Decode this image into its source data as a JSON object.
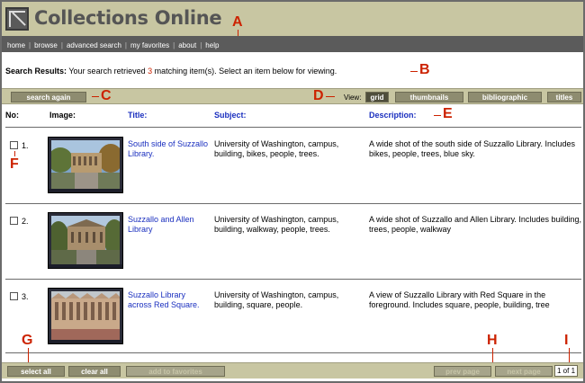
{
  "site": {
    "title": "Collections Online"
  },
  "nav": {
    "items": [
      "home",
      "browse",
      "advanced search",
      "my favorites",
      "about",
      "help"
    ],
    "separator": "|"
  },
  "search": {
    "label": "Search Results:",
    "text_before": "Your search retrieved",
    "count": "3",
    "text_after": "matching item(s). Select an item below for viewing."
  },
  "toolbar": {
    "search_again": "search again",
    "view_label": "View:",
    "views": [
      "grid",
      "thumbnails",
      "bibliographic",
      "titles"
    ],
    "active_view": "grid"
  },
  "columns": {
    "no": "No:",
    "image": "Image:",
    "title": "Title:",
    "subject": "Subject:",
    "description": "Description:"
  },
  "rows": [
    {
      "no": "1.",
      "title": "South side of Suzzallo Library.",
      "subject": "University of Washington, campus, building, bikes, people, trees.",
      "description": "A wide shot of the south side of Suzzallo Library. Includes bikes, people, trees, blue sky."
    },
    {
      "no": "2.",
      "title": "Suzzallo and Allen Library",
      "subject": "University of Washington, campus, building, walkway, people, trees.",
      "description": "A wide shot of Suzzallo and Allen Library. Includes building, trees, people, walkway"
    },
    {
      "no": "3.",
      "title": "Suzzallo Library across Red Square.",
      "subject": "University of Washington, campus, building, square, people.",
      "description": "A view of Suzzallo Library with Red Square in the foreground. Includes square, people, building, tree"
    }
  ],
  "bottom": {
    "select_all": "select all",
    "clear_all": "clear all",
    "add_to_favorites": "add to favorites",
    "prev_page": "prev page",
    "next_page": "next page",
    "page_indicator": "1 of 1"
  },
  "markers": [
    "A",
    "B",
    "C",
    "D",
    "E",
    "F",
    "G",
    "H",
    "I"
  ],
  "colors": {
    "header_bg": "#c8c6a2",
    "nav_bg": "#5b5b5b",
    "link": "#1a2fbf",
    "marker": "#cc2200",
    "active_view": "#4f4e3c"
  }
}
